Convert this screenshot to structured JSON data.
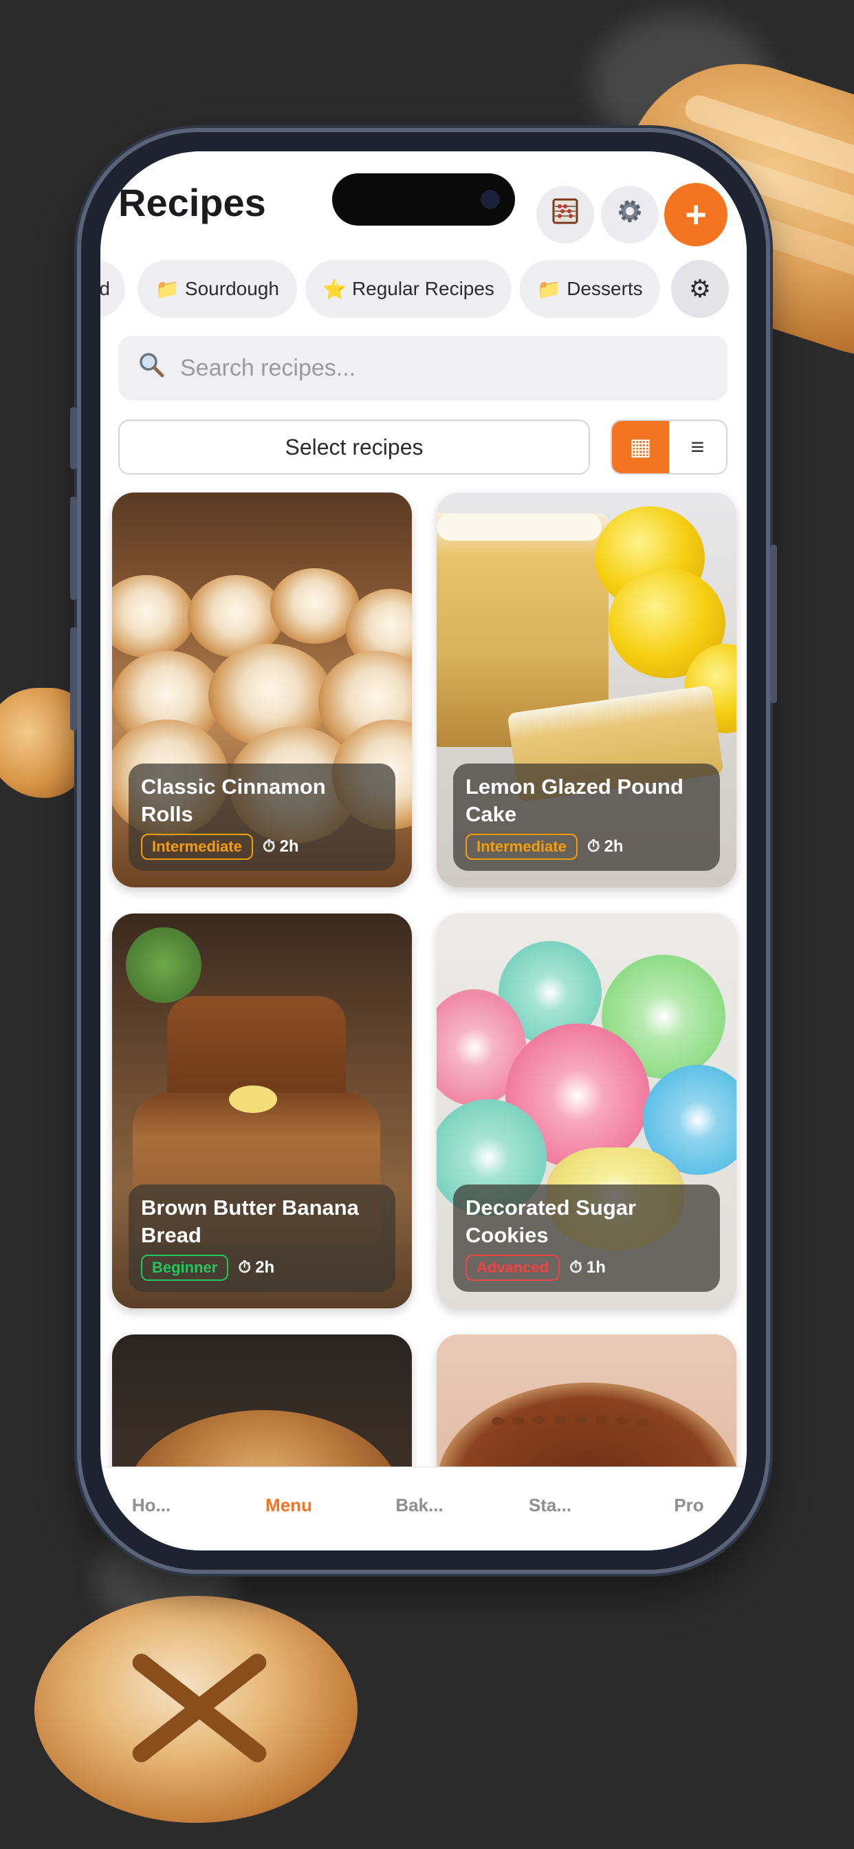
{
  "header": {
    "title": "Recipes"
  },
  "header_icons": {
    "abacus": "abacus-icon",
    "settings": "gear-icon",
    "add": "+"
  },
  "chips": [
    {
      "icon": "",
      "label": "d"
    },
    {
      "icon": "📁",
      "label": "Sourdough"
    },
    {
      "icon": "⭐",
      "label": "Regular Recipes"
    },
    {
      "icon": "📁",
      "label": "Desserts"
    },
    {
      "icon": "⚙",
      "label": ""
    }
  ],
  "search": {
    "placeholder": "Search recipes..."
  },
  "controls": {
    "select_label": "Select recipes",
    "grid_icon": "▦",
    "list_icon": "≡"
  },
  "recipes": [
    {
      "name": "Classic Cinnamon Rolls",
      "difficulty": "Intermediate",
      "time": "2h"
    },
    {
      "name": "Lemon Glazed Pound Cake",
      "difficulty": "Intermediate",
      "time": "2h"
    },
    {
      "name": "Brown Butter Banana Bread",
      "difficulty": "Beginner",
      "time": "2h"
    },
    {
      "name": "Decorated Sugar Cookies",
      "difficulty": "Advanced",
      "time": "1h"
    }
  ],
  "tabs": [
    {
      "label": "Ho...",
      "active": false
    },
    {
      "label": "Menu",
      "active": true
    },
    {
      "label": "Bak...",
      "active": false
    },
    {
      "label": "Sta...",
      "active": false
    },
    {
      "label": "Pro",
      "active": false
    }
  ],
  "colors": {
    "accent": "#f47521",
    "intermediate": "#f59e0b",
    "beginner": "#22c55e",
    "advanced": "#ef4444"
  },
  "time_icon": "⏱"
}
